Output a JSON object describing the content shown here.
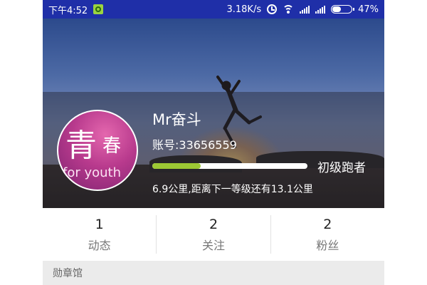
{
  "status_bar": {
    "time": "下午4:52",
    "speed": "3.18K/s",
    "battery": "47%",
    "icons": [
      "notification-icon",
      "alarm-icon",
      "wifi-icon",
      "signal-icon",
      "battery-icon"
    ]
  },
  "profile": {
    "avatar_text": {
      "line1": "青",
      "line2": "春",
      "line3": "for youth"
    },
    "username": "Mr奋斗",
    "account": "账号:33656559",
    "level": "初级跑者",
    "level_progress": 0.31,
    "distance_text": "6.9公里,距离下一等级还有13.1公里"
  },
  "stats": [
    {
      "count": "1",
      "label": "动态"
    },
    {
      "count": "2",
      "label": "关注"
    },
    {
      "count": "2",
      "label": "粉丝"
    }
  ],
  "section": {
    "title": "勋章馆"
  },
  "colors": {
    "status_bar": "#1f2fa8",
    "progress": "#9cc834",
    "badge_bar": "#ebebeb"
  }
}
